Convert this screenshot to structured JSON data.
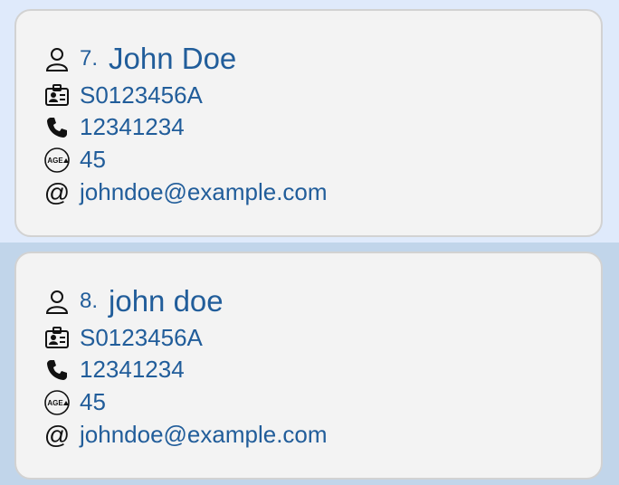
{
  "persons": [
    {
      "index": "7.",
      "name": "John Doe",
      "nric": "S0123456A",
      "phone": "12341234",
      "age": "45",
      "email": "johndoe@example.com"
    },
    {
      "index": "8.",
      "name": "john doe",
      "nric": "S0123456A",
      "phone": "12341234",
      "age": "45",
      "email": "johndoe@example.com"
    }
  ],
  "icons": {
    "person": "person-icon",
    "nric": "id-card-icon",
    "phone": "phone-icon",
    "age": "age-icon",
    "email": "at-icon",
    "age_badge_text": "AGE"
  },
  "colors": {
    "text": "#215d9a",
    "row_selected": "#dfeafb",
    "row_alt": "#c1d5ea",
    "card": "#f3f3f3"
  }
}
